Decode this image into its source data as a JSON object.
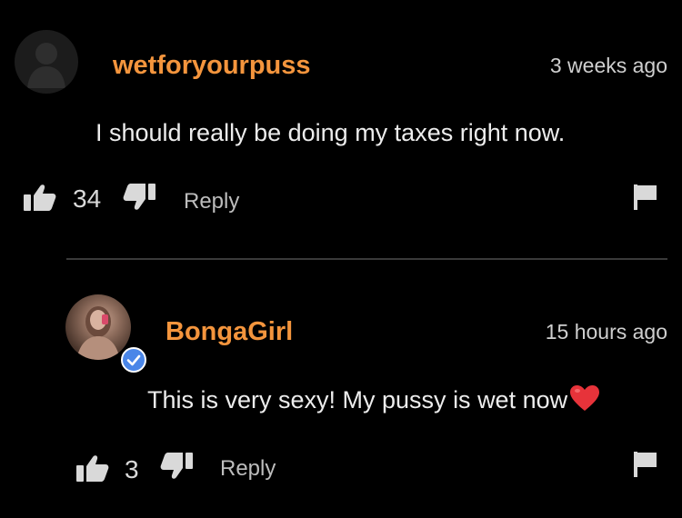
{
  "colors": {
    "background": "#000000",
    "username": "#f4953d",
    "verified_badge": "#4a86e8",
    "heart": "#e7333a"
  },
  "comments": [
    {
      "username": "wetforyourpuss",
      "timestamp": "3 weeks ago",
      "text": "I should really be doing my taxes right now.",
      "likes": "34",
      "reply_label": "Reply",
      "avatar": "default-avatar-icon"
    },
    {
      "username": "BongaGirl",
      "timestamp": "15 hours ago",
      "text": "This is very sexy! My pussy is wet now",
      "emoji": "❤️",
      "likes": "3",
      "reply_label": "Reply",
      "avatar": "photo-avatar",
      "verified": true
    }
  ]
}
